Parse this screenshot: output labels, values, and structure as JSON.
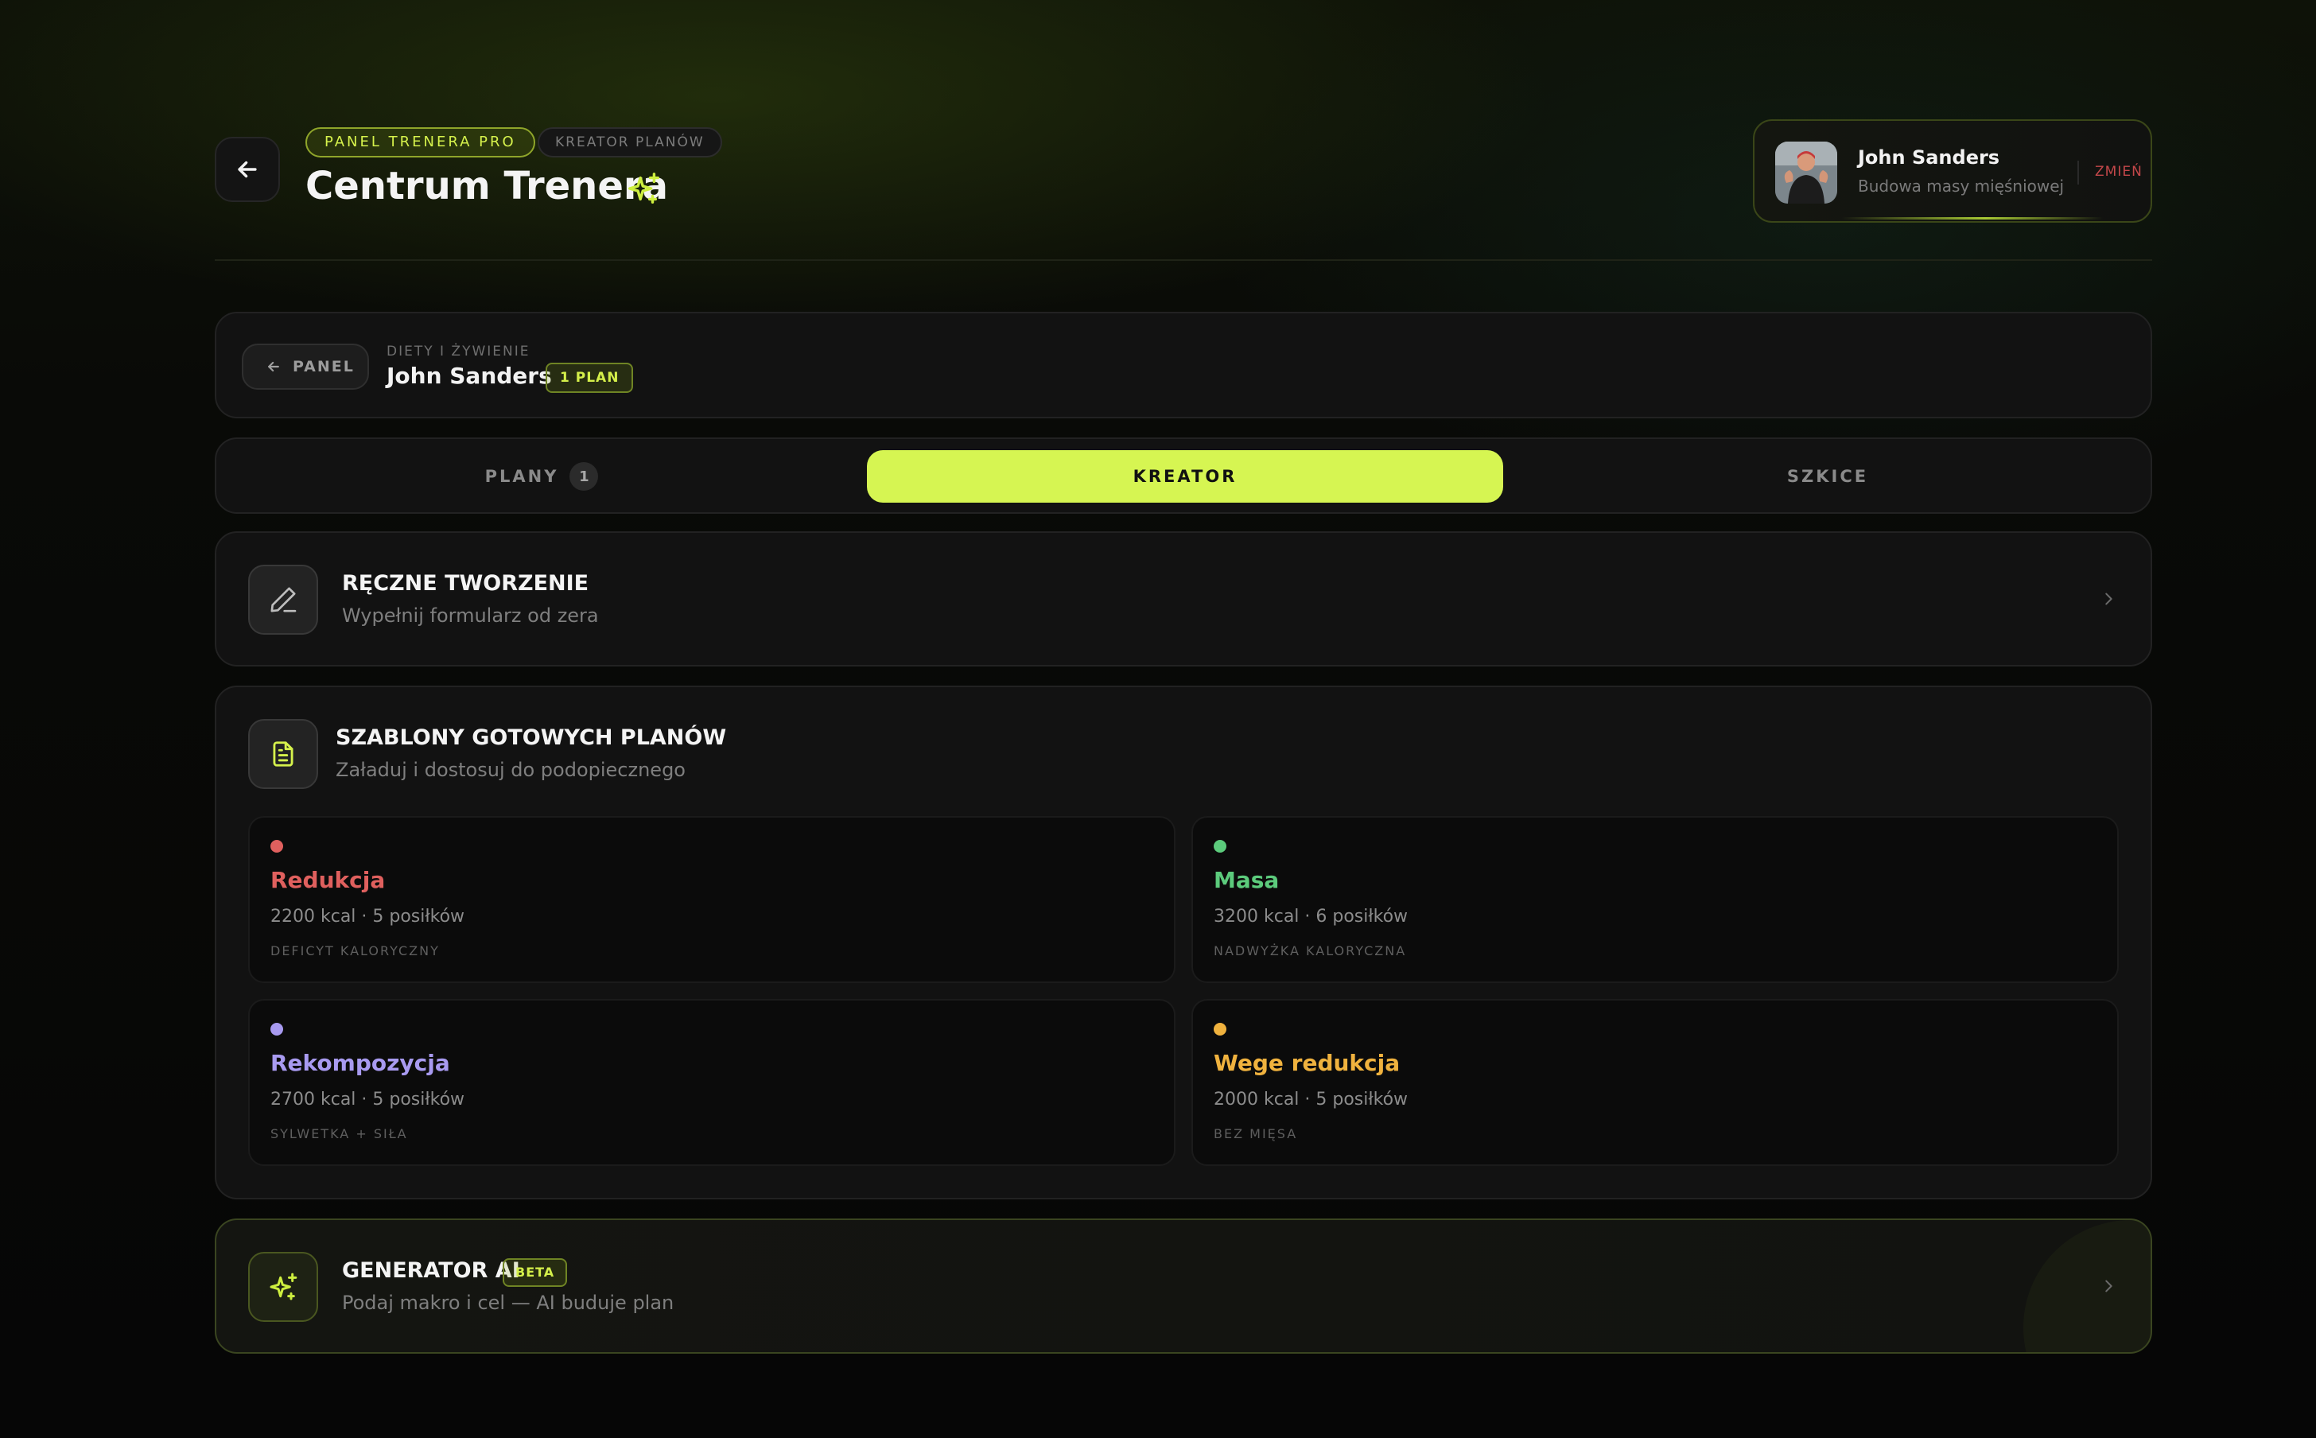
{
  "header": {
    "badge_pro": "PANEL TRENERA PRO",
    "badge_creator": "KREATOR PLANÓW",
    "title": "Centrum Trenera"
  },
  "client": {
    "name": "John Sanders",
    "goal": "Budowa masy mięśniowej",
    "change_label": "ZMIEŃ"
  },
  "breadcrumb": {
    "back_label": "PANEL",
    "section": "DIETY I ŻYWIENIE",
    "client_name": "John Sanders",
    "plan_count_badge": "1 PLAN"
  },
  "tabs": [
    {
      "label": "PLANY",
      "count": "1",
      "active": false
    },
    {
      "label": "KREATOR",
      "active": true
    },
    {
      "label": "SZKICE",
      "active": false
    }
  ],
  "manual": {
    "title": "RĘCZNE TWORZENIE",
    "subtitle": "Wypełnij formularz od zera"
  },
  "templates": {
    "title": "SZABLONY GOTOWYCH PLANÓW",
    "subtitle": "Załaduj i dostosuj do podopiecznego",
    "items": [
      {
        "name": "Redukcja",
        "meta": "2200 kcal · 5 posiłków",
        "tag": "DEFICYT KALORYCZNY",
        "color": "#e0605e"
      },
      {
        "name": "Masa",
        "meta": "3200 kcal · 6 posiłków",
        "tag": "NADWYŻKA KALORYCZNA",
        "color": "#5ccb7c"
      },
      {
        "name": "Rekompozycja",
        "meta": "2700 kcal · 5 posiłków",
        "tag": "SYLWETKA + SIŁA",
        "color": "#a89af0"
      },
      {
        "name": "Wege redukcja",
        "meta": "2000 kcal · 5 posiłków",
        "tag": "BEZ MIĘSA",
        "color": "#f0b23e"
      }
    ]
  },
  "ai": {
    "title": "GENERATOR AI",
    "badge": "BETA",
    "subtitle": "Podaj makro i cel — AI buduje plan"
  },
  "colors": {
    "accent": "#d6f552",
    "background": "#070707",
    "card": "#121212"
  }
}
